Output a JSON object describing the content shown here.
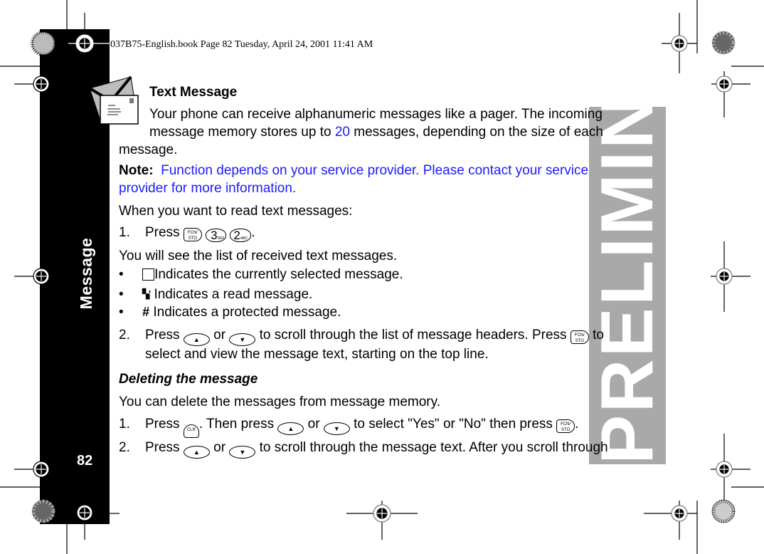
{
  "header": {
    "print_line": "037B75-English.book  Page 82  Tuesday, April 24, 2001  11:41 AM"
  },
  "sidebar": {
    "tab_label": "Message",
    "page_number": "82"
  },
  "watermark": {
    "text": "PRELIMINARY"
  },
  "section": {
    "icon": "envelope-icon",
    "title": "Text Message",
    "intro_line1": "Your phone can receive alphanumeric messages like a pager. The incoming",
    "intro_line2_pre": "message memory stores up to ",
    "intro_count": "20",
    "intro_line2_post": " messages, depending on the size of each",
    "intro_line3": "message.",
    "note_label": "Note:",
    "note_line1": "Function depends on your service provider. Please contact your service",
    "note_line2": "provider for more information.",
    "read_intro": "When you want to read text messages:",
    "step1": {
      "number": "1.",
      "press": "Press",
      "keys": [
        "FCN/STO",
        "3 DEF",
        "2 ABC"
      ],
      "end": "."
    },
    "list_intro": "You will see the list of received text messages.",
    "bullets": [
      {
        "icon": "selected-box-icon",
        "text": "Indicates the currently selected message."
      },
      {
        "icon": "read-check-icon",
        "text": "Indicates a read message."
      },
      {
        "icon": "protected-hash-icon",
        "text": "Indicates a protected message."
      }
    ],
    "bullet_glyph": "•",
    "step2": {
      "number": "2.",
      "press": "Press",
      "or": "or",
      "middle": "to scroll through the list of message headers. Press",
      "to": "to",
      "line2": "select and view the message text, starting on the top line."
    }
  },
  "deleting": {
    "title": "Deleting the message",
    "intro": "You can delete the messages from message memory.",
    "step1": {
      "number": "1.",
      "press": "Press",
      "then": ". Then press",
      "or": "or",
      "middle": "to select \"Yes\" or \"No\" then press",
      "end": "."
    },
    "step2": {
      "number": "2.",
      "press": "Press",
      "or": "or",
      "text": "to scroll through the message text. After you scroll through"
    }
  },
  "keys": {
    "fcn_top": "FCN/",
    "fcn_bottom": "STO",
    "three": "3",
    "three_sub": "DEF",
    "two": "2",
    "two_sub": "ABC",
    "up": "▲",
    "down": "▼",
    "clr": "CLR"
  },
  "glyphs": {
    "read": "▚'",
    "hash": "#"
  }
}
